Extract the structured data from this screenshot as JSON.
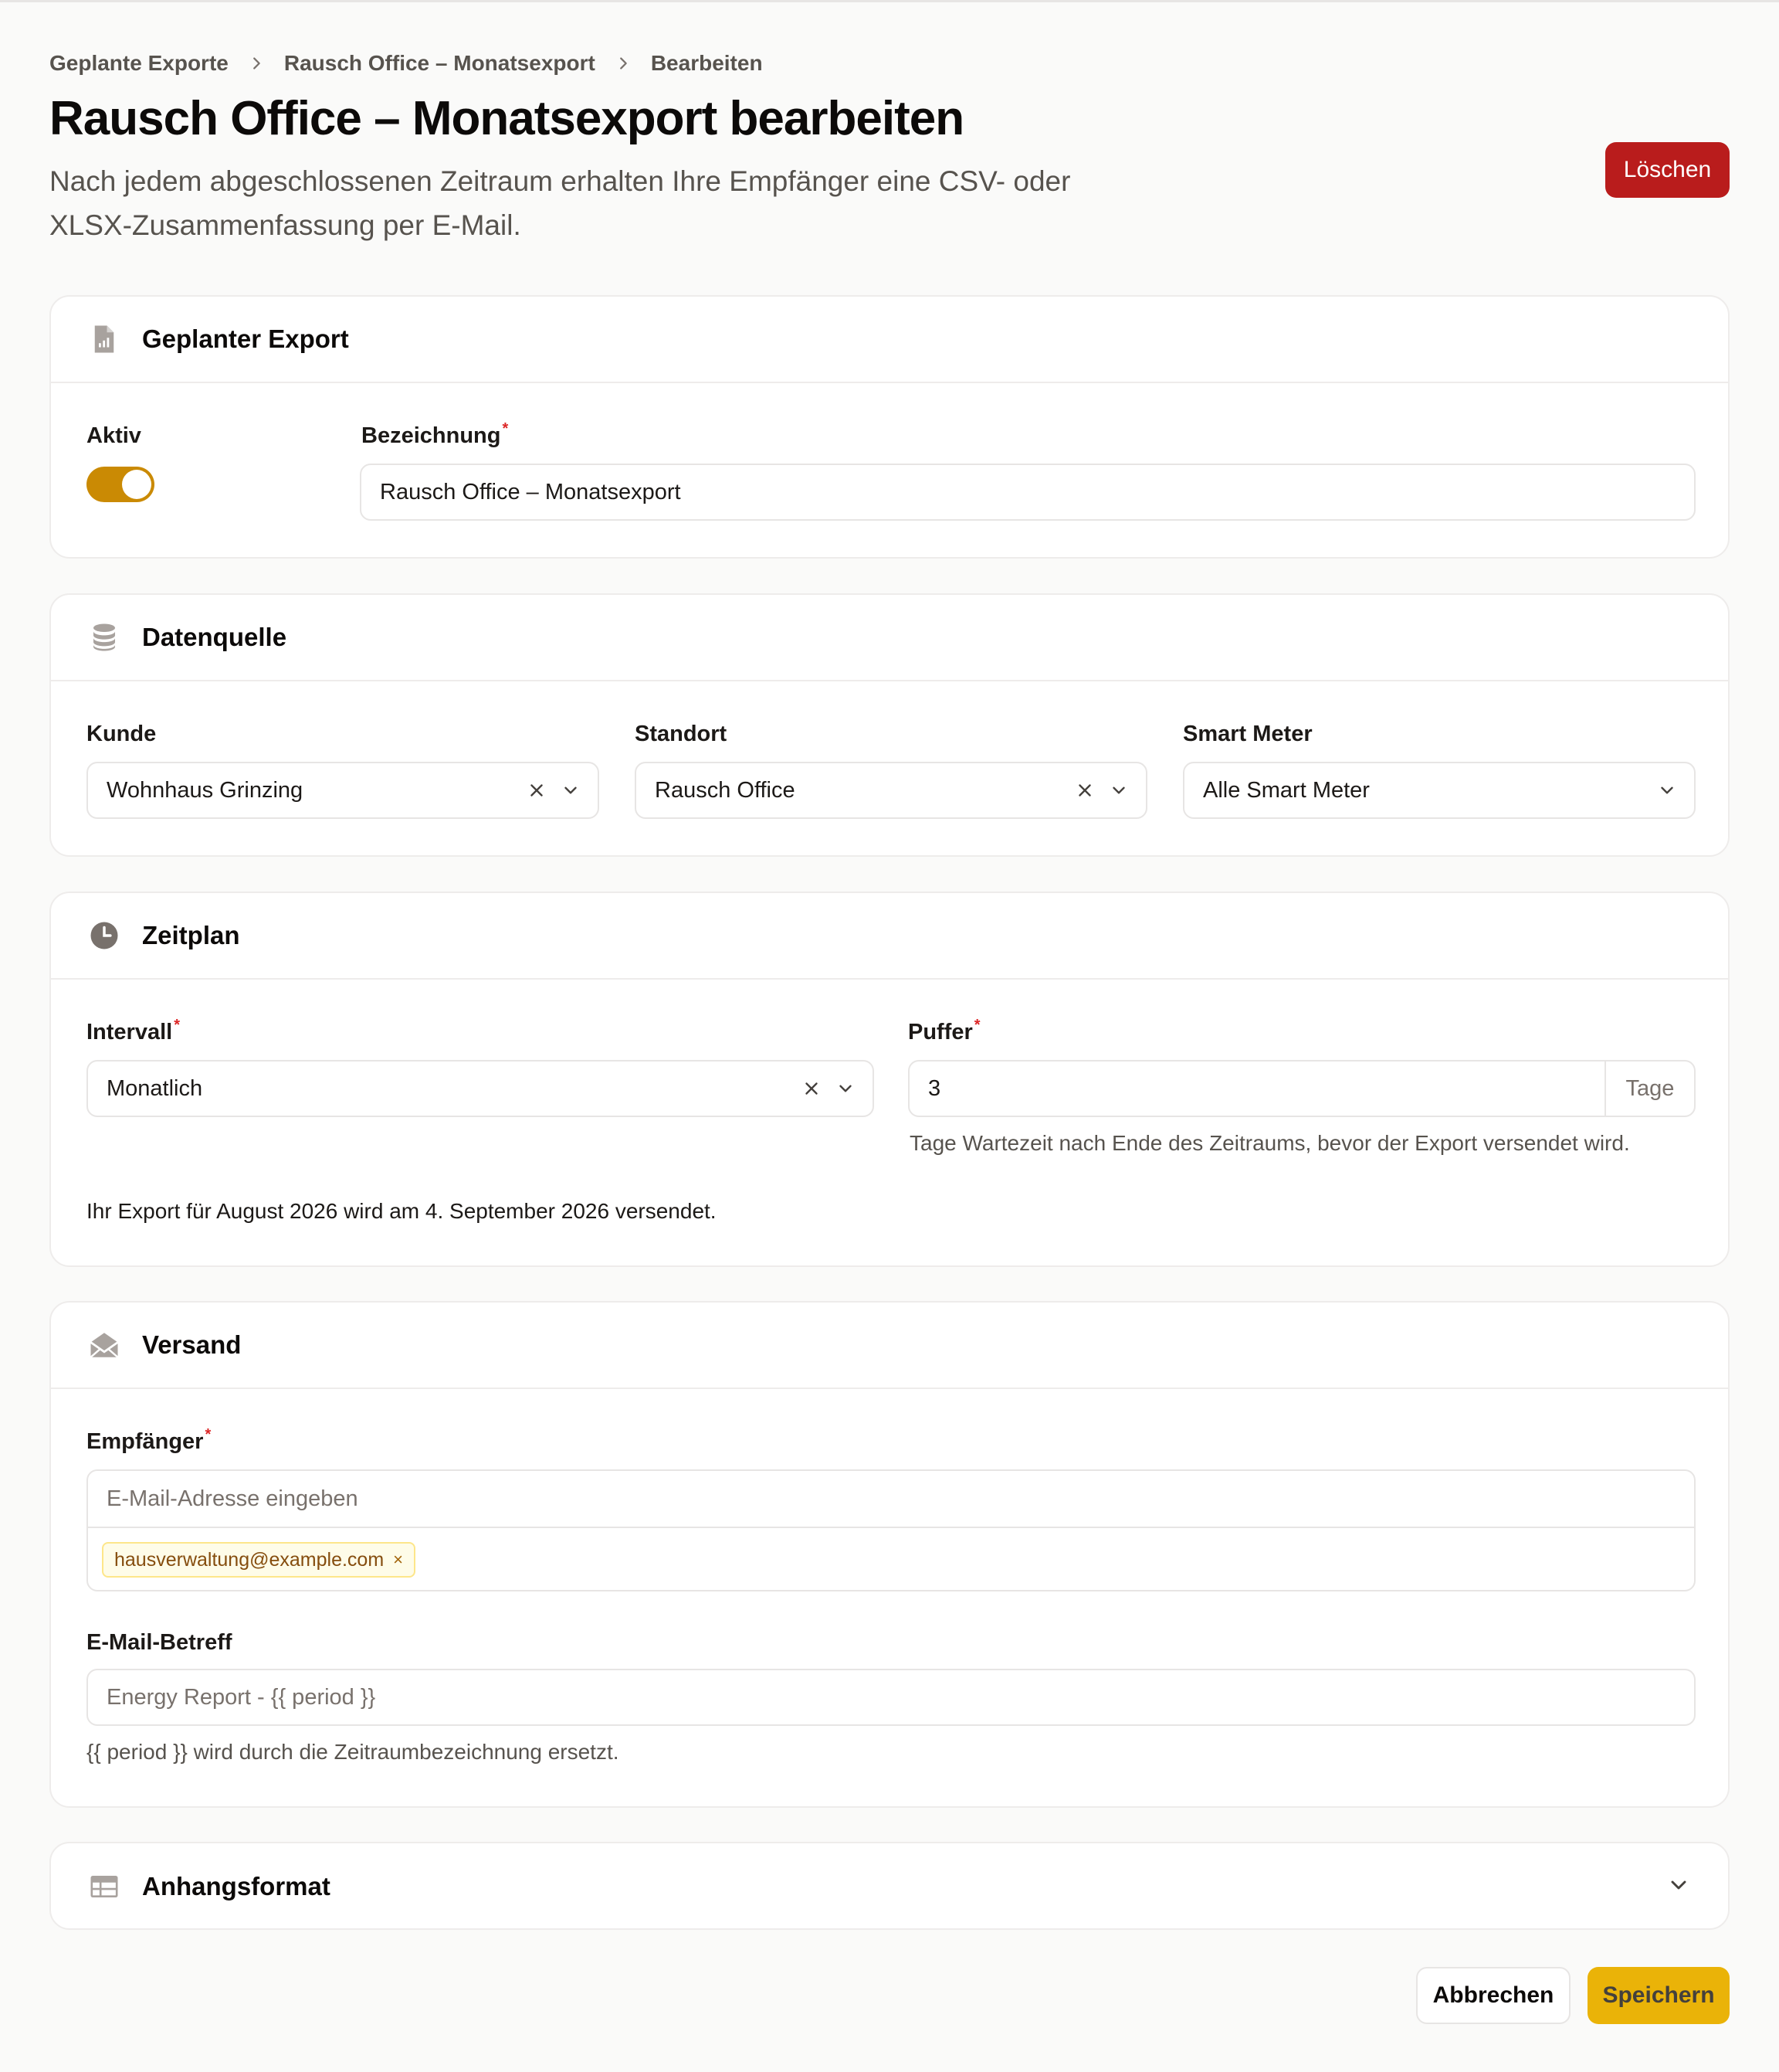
{
  "breadcrumb": {
    "items": [
      "Geplante Exporte",
      "Rausch Office – Monatsexport",
      "Bearbeiten"
    ]
  },
  "header": {
    "title": "Rausch Office – Monatsexport bearbeiten",
    "subtitle": "Nach jedem abgeschlossenen Zeitraum erhalten Ihre Empfänger eine CSV- oder XLSX-Zusammenfassung per E-Mail.",
    "delete_label": "Löschen"
  },
  "colors": {
    "accent": "#eab308",
    "toggle_on": "#ca8a04",
    "danger": "#b91c1c"
  },
  "export_card": {
    "title": "Geplanter Export",
    "icon": "file-chart-icon",
    "active_label": "Aktiv",
    "active": true,
    "name_label": "Bezeichnung",
    "required_mark": "*",
    "name_value": "Rausch Office – Monatsexport"
  },
  "source_card": {
    "title": "Datenquelle",
    "icon": "database-icon",
    "customer_label": "Kunde",
    "customer_value": "Wohnhaus Grinzing",
    "location_label": "Standort",
    "location_value": "Rausch Office",
    "meter_label": "Smart Meter",
    "meter_value": "Alle Smart Meter"
  },
  "schedule_card": {
    "title": "Zeitplan",
    "icon": "clock-icon",
    "interval_label": "Intervall",
    "interval_value": "Monatlich",
    "buffer_label": "Puffer",
    "buffer_value": "3",
    "buffer_suffix": "Tage",
    "buffer_help": "Tage Wartezeit nach Ende des Zeitraums, bevor der Export versendet wird.",
    "next_info": "Ihr Export für August 2026 wird am 4. September 2026 versendet."
  },
  "delivery_card": {
    "title": "Versand",
    "icon": "envelope-open-icon",
    "recipients_label": "Empfänger",
    "recipients_placeholder": "E-Mail-Adresse eingeben",
    "recipients": [
      "hausverwaltung@example.com"
    ],
    "tag_remove": "×",
    "subject_label": "E-Mail-Betreff",
    "subject_placeholder": "Energy Report - {{ period }}",
    "subject_help": "{{ period }} wird durch die Zeitraumbezeichnung ersetzt."
  },
  "attachment_card": {
    "title": "Anhangsformat",
    "icon": "table-icon"
  },
  "footer": {
    "cancel_label": "Abbrechen",
    "save_label": "Speichern"
  }
}
